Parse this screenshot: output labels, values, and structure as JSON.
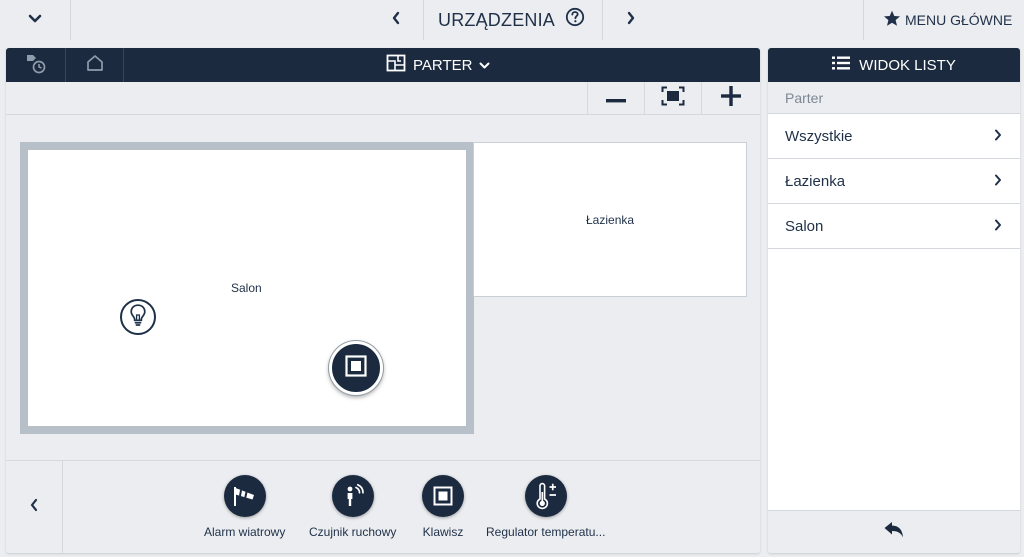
{
  "topbar": {
    "title": "URZĄDZENIA",
    "main_menu_label": "MENU GŁÓWNE",
    "icons": {
      "collapse": "chevron-down-icon",
      "prev": "chevron-left-icon",
      "help": "help-circle-icon",
      "next": "chevron-right-icon",
      "star": "star-icon"
    }
  },
  "floor_panel": {
    "floor_label": "PARTER",
    "header_icons": [
      "scene-timer-icon",
      "home-icon",
      "floorplan-icon",
      "chevron-down-icon"
    ],
    "zoom_icons": [
      "zoom-out-icon",
      "fit-screen-icon",
      "zoom-in-icon"
    ],
    "rooms": [
      {
        "name": "Salon"
      },
      {
        "name": "Łazienka"
      }
    ],
    "placed_devices": [
      "lightbulb-icon",
      "key-switch-icon"
    ]
  },
  "device_bar": {
    "back_icon": "chevron-left-icon",
    "items": [
      {
        "label": "Alarm wiatrowy",
        "icon": "windsock-icon"
      },
      {
        "label": "Czujnik ruchowy",
        "icon": "motion-sensor-icon"
      },
      {
        "label": "Klawisz",
        "icon": "key-switch-icon"
      },
      {
        "label": "Regulator temperatu...",
        "icon": "thermostat-icon"
      }
    ]
  },
  "list_panel": {
    "header_label": "WIDOK LISTY",
    "header_icon": "list-icon",
    "breadcrumb": "Parter",
    "items": [
      {
        "label": "Wszystkie"
      },
      {
        "label": "Łazienka"
      },
      {
        "label": "Salon"
      }
    ],
    "footer_icon": "back-arrow-icon"
  },
  "colors": {
    "header_bg": "#1b2a3f",
    "background": "#ebedf0",
    "text": "#1f3048",
    "room_border": "#b7c0c8"
  }
}
